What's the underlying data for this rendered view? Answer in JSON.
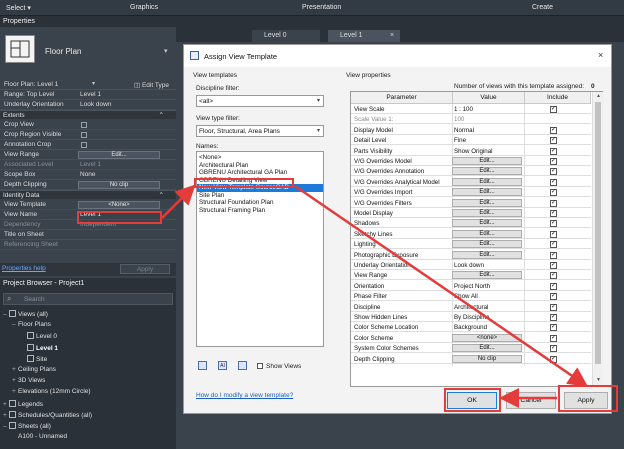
{
  "ribbon": {
    "select": "Select ▾",
    "graphics": "Graphics",
    "presentation": "Presentation",
    "create": "Create"
  },
  "properties": {
    "title": "Properties",
    "type_name": "Floor Plan",
    "instance_label": "Floor Plan: Level 1",
    "edit_type": "Edit Type",
    "rows_top": [
      {
        "k": "Range: Top Level",
        "v": "Level 1"
      },
      {
        "k": "Underlay Orientation",
        "v": "Look down"
      }
    ],
    "extents_label": "Extents",
    "extents_rows": [
      {
        "k": "Crop View",
        "check": true
      },
      {
        "k": "Crop Region Visible",
        "check": true
      },
      {
        "k": "Annotation Crop",
        "check": true
      },
      {
        "k": "View Range",
        "btn": "Edit..."
      },
      {
        "k": "Associated Level",
        "v": "Level 1",
        "dim": true
      },
      {
        "k": "Scope Box",
        "v": "None"
      },
      {
        "k": "Depth Clipping",
        "btn": "No clip"
      }
    ],
    "identity_label": "Identity Data",
    "identity_rows": [
      {
        "k": "View Template",
        "btn": "<None>"
      },
      {
        "k": "View Name",
        "v": "Level 1"
      },
      {
        "k": "Dependency",
        "v": "Independent",
        "dim": true
      },
      {
        "k": "Title on Sheet",
        "v": ""
      },
      {
        "k": "Referencing Sheet",
        "v": "",
        "dim": true
      }
    ],
    "help_link": "Properties help",
    "apply": "Apply"
  },
  "browser": {
    "title": "Project Browser - Project1",
    "search_placeholder": "Search",
    "items": [
      {
        "label": "Views (all)",
        "level": 0,
        "tri": "–",
        "sq": true
      },
      {
        "label": "Floor Plans",
        "level": 1,
        "tri": "–"
      },
      {
        "label": "Level 0",
        "level": 2,
        "sq": true
      },
      {
        "label": "Level 1",
        "level": 2,
        "sq": true,
        "bold": true
      },
      {
        "label": "Site",
        "level": 2,
        "sq": true
      },
      {
        "label": "Ceiling Plans",
        "level": 1,
        "tri": "+"
      },
      {
        "label": "3D Views",
        "level": 1,
        "tri": "+"
      },
      {
        "label": "Elevations (12mm Circle)",
        "level": 1,
        "tri": "+"
      },
      {
        "label": "Legends",
        "level": 0,
        "tri": "+",
        "sq": true
      },
      {
        "label": "Schedules/Quantities (all)",
        "level": 0,
        "tri": "+",
        "sq": true
      },
      {
        "label": "Sheets (all)",
        "level": 0,
        "tri": "–",
        "sq": true
      },
      {
        "label": "A100 - Unnamed",
        "level": 1
      }
    ]
  },
  "tabs": [
    {
      "label": "Level 0"
    },
    {
      "label": "Level 1"
    }
  ],
  "dialog": {
    "title": "Assign View Template",
    "view_templates_label": "View templates",
    "discipline_label": "Discipline filter:",
    "discipline_value": "<all>",
    "type_label": "View type filter:",
    "type_value": "Floor, Structural, Area Plans",
    "names_label": "Names:",
    "names": [
      "<None>",
      "Architectural Plan",
      "GBRENU Architectural GA Plan",
      "GBRENU Detailing View",
      "New View Template SourceCAD",
      "Site Plan",
      "Structural Foundation Plan",
      "Structural Framing Plan"
    ],
    "selected_index": 4,
    "show_views": "Show Views",
    "help_link": "How do I modify a view template?",
    "view_properties_label": "View properties",
    "assigned_label": "Number of views with this template assigned:",
    "assigned_count": "0",
    "columns": [
      "Parameter",
      "Value",
      "Include"
    ],
    "rows": [
      {
        "p": "View Scale",
        "v": "1 : 100",
        "inc": true
      },
      {
        "p": "Scale Value 1:",
        "v": "100",
        "dim": true
      },
      {
        "p": "Display Model",
        "v": "Normal",
        "inc": true
      },
      {
        "p": "Detail Level",
        "v": "Fine",
        "inc": true
      },
      {
        "p": "Parts Visibility",
        "v": "Show Original",
        "inc": true
      },
      {
        "p": "V/G Overrides Model",
        "btn": "Edit...",
        "inc": true
      },
      {
        "p": "V/G Overrides Annotation",
        "btn": "Edit...",
        "inc": true
      },
      {
        "p": "V/G Overrides Analytical Model",
        "btn": "Edit...",
        "inc": true
      },
      {
        "p": "V/G Overrides Import",
        "btn": "Edit...",
        "inc": true
      },
      {
        "p": "V/G Overrides Filters",
        "btn": "Edit...",
        "inc": true
      },
      {
        "p": "Model Display",
        "btn": "Edit...",
        "inc": true
      },
      {
        "p": "Shadows",
        "btn": "Edit...",
        "inc": true
      },
      {
        "p": "Sketchy Lines",
        "btn": "Edit...",
        "inc": true
      },
      {
        "p": "Lighting",
        "btn": "Edit...",
        "inc": true
      },
      {
        "p": "Photographic Exposure",
        "btn": "Edit...",
        "inc": true
      },
      {
        "p": "Underlay Orientation",
        "v": "Look down",
        "inc": true
      },
      {
        "p": "View Range",
        "btn": "Edit...",
        "inc": true
      },
      {
        "p": "Orientation",
        "v": "Project North",
        "inc": true
      },
      {
        "p": "Phase Filter",
        "v": "Show All",
        "inc": true
      },
      {
        "p": "Discipline",
        "v": "Architectural",
        "inc": true
      },
      {
        "p": "Show Hidden Lines",
        "v": "By Discipline",
        "inc": true
      },
      {
        "p": "Color Scheme Location",
        "v": "Background",
        "inc": true
      },
      {
        "p": "Color Scheme",
        "btn": "<none>",
        "inc": true
      },
      {
        "p": "System Color Schemes",
        "btn": "Edit...",
        "inc": true
      },
      {
        "p": "Depth Clipping",
        "btn": "No clip",
        "inc": true
      }
    ],
    "ok": "OK",
    "cancel": "Cancel",
    "apply": "Apply"
  },
  "colors": {
    "highlight": "#e53b3b",
    "selection": "#1e7ad8"
  }
}
